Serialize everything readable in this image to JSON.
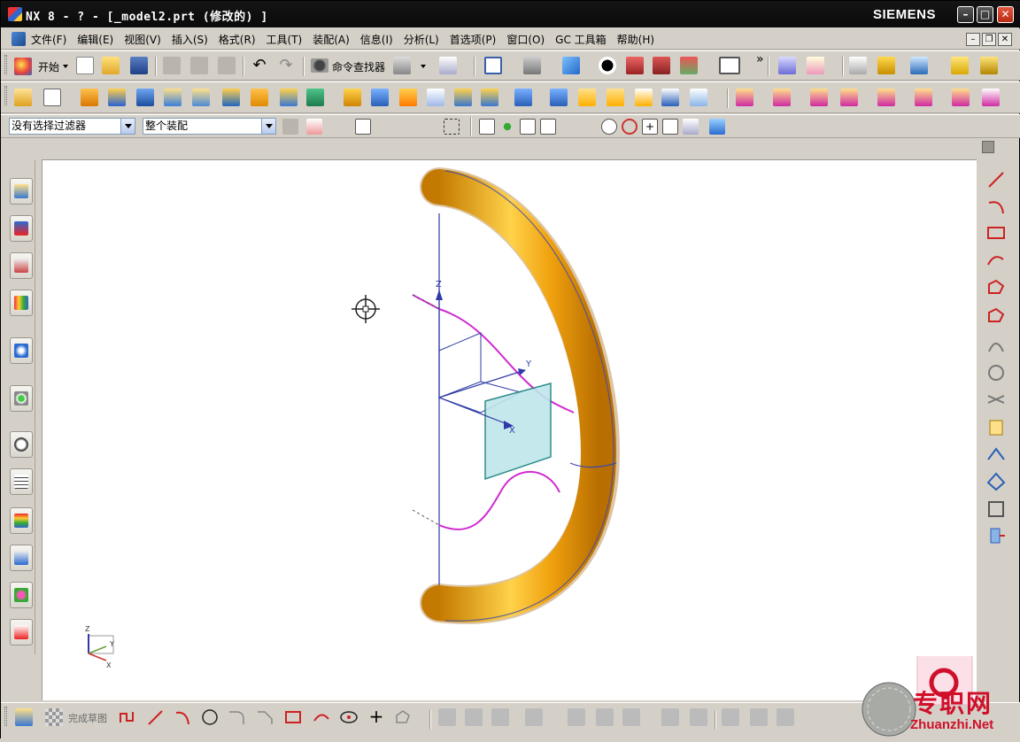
{
  "window": {
    "title": "NX 8 - ? - [_model2.prt  (修改的) ]",
    "brand": "SIEMENS",
    "min_glyph": "–",
    "max_glyph": "□",
    "close_glyph": "✕"
  },
  "menu": {
    "items": [
      "文件(F)",
      "编辑(E)",
      "视图(V)",
      "插入(S)",
      "格式(R)",
      "工具(T)",
      "装配(A)",
      "信息(I)",
      "分析(L)",
      "首选项(P)",
      "窗口(O)",
      "GC 工具箱",
      "帮助(H)"
    ]
  },
  "toolbar": {
    "start_label": "开始",
    "command_finder_label": "命令查找器",
    "overflow_glyph": "»"
  },
  "selection": {
    "filter_value": "没有选择过滤器",
    "scope_value": "整个装配"
  },
  "sketch": {
    "finish_label": "完成草图"
  },
  "viewport": {
    "axis_labels": {
      "z": "Z",
      "y": "Y",
      "x": "X"
    },
    "triad_labels": {
      "z": "Z",
      "y": "Y",
      "x": "X"
    }
  },
  "watermark": {
    "text": "专职网",
    "url": "Zhuanzhi.Net"
  },
  "colors": {
    "tube": "#f0a10e",
    "tube_shadow": "#c47a00",
    "guide_curve": "#d12ad1",
    "datum": "#2f3aa6",
    "sketch_plane": "#bfe6ea",
    "brand_red": "#d0102a"
  }
}
